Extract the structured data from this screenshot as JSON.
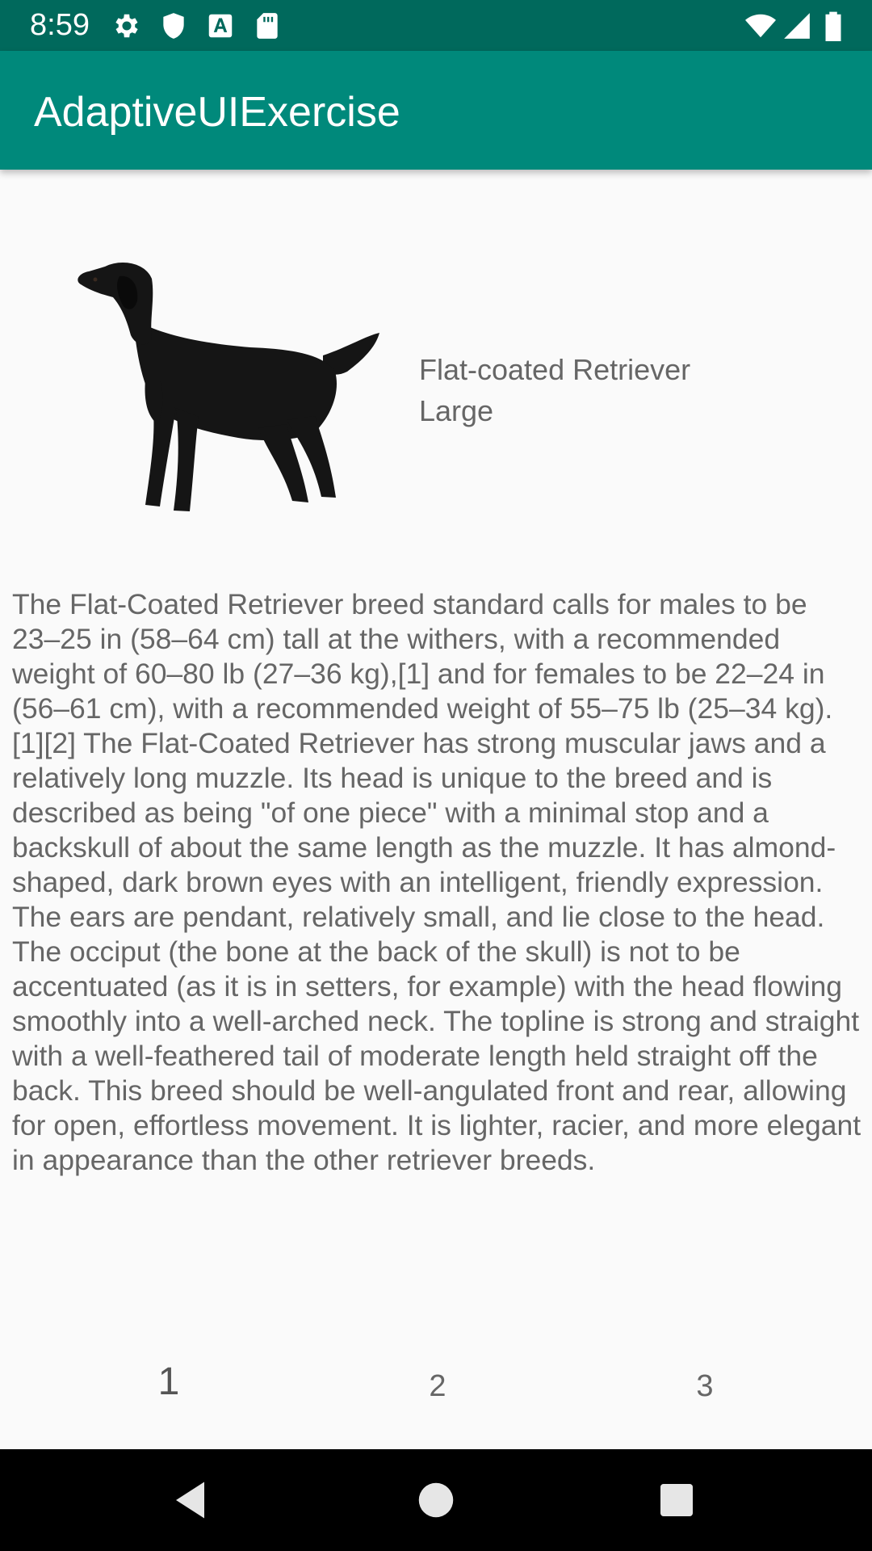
{
  "status_bar": {
    "time": "8:59",
    "left_icons": [
      "gear-icon",
      "shield-icon",
      "font-icon",
      "sd-card-icon"
    ],
    "right_icons": [
      "wifi-icon",
      "signal-icon",
      "battery-icon"
    ]
  },
  "app_bar": {
    "title": "AdaptiveUIExercise",
    "color": "#00897b"
  },
  "breed": {
    "image_icon": "dog-photo",
    "name": "Flat-coated Retriever",
    "size": "Large",
    "description": "The Flat-Coated Retriever breed standard calls for males to be 23–25 in (58–64 cm) tall at the withers, with a recommended weight of 60–80 lb (27–36 kg),[1] and for females to be 22–24 in (56–61 cm), with a recommended weight of 55–75 lb (25–34 kg).[1][2] The Flat-Coated Retriever has strong muscular jaws and a relatively long muzzle. Its head is unique to the breed and is described as being \"of one piece\" with a minimal stop and a backskull of about the same length as the muzzle. It has almond-shaped, dark brown eyes with an intelligent, friendly expression. The ears are pendant, relatively small, and lie close to the head. The occiput (the bone at the back of the skull) is not to be accentuated (as it is in setters, for example) with the head flowing smoothly into a well-arched neck. The topline is strong and straight with a well-feathered tail of moderate length held straight off the back. This breed should be well-angulated front and rear, allowing for open, effortless movement. It is lighter, racier, and more elegant in appearance than the other retriever breeds."
  },
  "pages": [
    "1",
    "2",
    "3"
  ],
  "nav_bar": {
    "buttons": [
      "back-icon",
      "home-icon",
      "recents-icon"
    ]
  }
}
